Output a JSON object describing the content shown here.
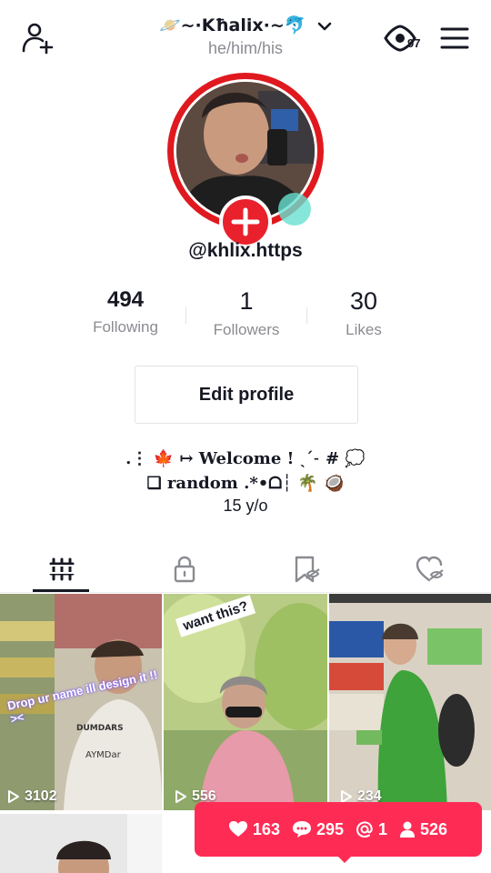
{
  "header": {
    "display_name": "🪐~·Kħalix·~🐬",
    "pronouns": "he/him/his",
    "profile_views": "97"
  },
  "profile": {
    "username": "@khlix.https",
    "edit_label": "Edit profile"
  },
  "stats": [
    {
      "value": "494",
      "label": "Following"
    },
    {
      "value": "1",
      "label": "Followers"
    },
    {
      "value": "30",
      "label": "Likes"
    }
  ],
  "bio": {
    "line1_prefix": ".⋮",
    "line1_text": "↦ Welcome ! ˎˊ˗ #",
    "line2_text": "❏ random .*•ᗝ┆",
    "line3": "15 y/o"
  },
  "tabs": [
    "videos-grid",
    "private-lock",
    "reposts",
    "liked"
  ],
  "videos": [
    {
      "views": "3102",
      "caption": "Drop ur name ill design it !! ><"
    },
    {
      "views": "556",
      "caption": "want this?"
    },
    {
      "views": "234",
      "caption": ""
    }
  ],
  "notification": {
    "likes": "163",
    "comments": "295",
    "mentions": "1",
    "followers": "526"
  },
  "colors": {
    "accent": "#fe2c55",
    "ring": "#e0191f",
    "text": "#161823",
    "secondary": "#8a8b91"
  }
}
